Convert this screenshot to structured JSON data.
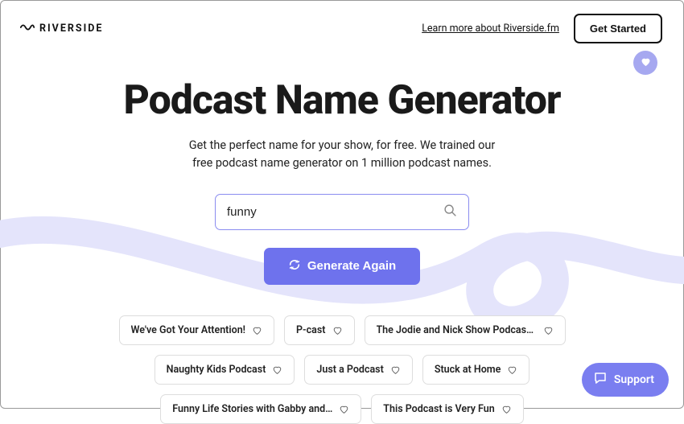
{
  "header": {
    "brand": "RIVERSIDE",
    "learn_link": "Learn more about Riverside.fm",
    "get_started": "Get Started"
  },
  "main": {
    "title": "Podcast Name Generator",
    "subtitle_line1": "Get the perfect name for your show, for free. We trained our",
    "subtitle_line2": "free podcast name generator on 1 million podcast names.",
    "search_value": "funny",
    "generate_label": "Generate Again"
  },
  "results": [
    "We've Got Your Attention!",
    "P-cast",
    "The Jodie and Nick Show Podcast is ...",
    "Naughty Kids Podcast",
    "Just a Podcast",
    "Stuck at Home",
    "Funny Life Stories with Gabby and Ai...",
    "This Podcast is Very Fun"
  ],
  "support": {
    "label": "Support"
  },
  "colors": {
    "accent": "#6e72ed",
    "swirl": "#e4e4fb"
  }
}
